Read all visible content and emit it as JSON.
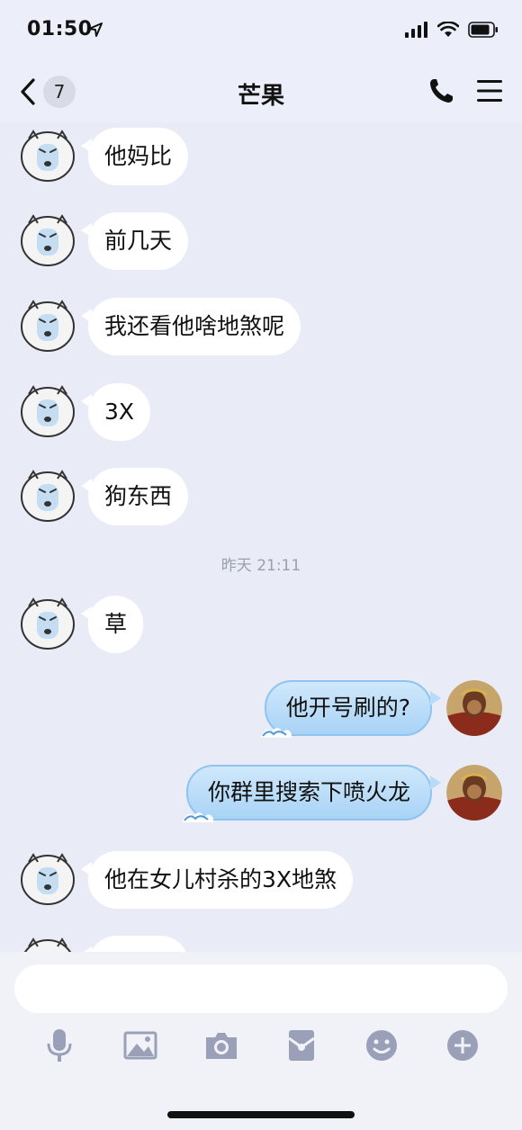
{
  "status_bar": {
    "time": "01:50"
  },
  "header": {
    "back_count": "7",
    "title": "芒果"
  },
  "messages": [
    {
      "side": "left",
      "text": "他妈比"
    },
    {
      "side": "left",
      "text": "前几天"
    },
    {
      "side": "left",
      "text": "我还看他啥地煞呢"
    },
    {
      "side": "left",
      "text": "3X"
    },
    {
      "side": "left",
      "text": "狗东西"
    },
    {
      "side": "left",
      "text": "草"
    },
    {
      "side": "right",
      "text": "他开号刷的?"
    },
    {
      "side": "right",
      "text": "你群里搜索下喷火龙"
    },
    {
      "side": "left",
      "text": "他在女儿村杀的3X地煞"
    }
  ],
  "timestamp": "昨天 21:11",
  "input": {
    "placeholder": "",
    "value": ""
  },
  "toolbar_icons": [
    "microphone-icon",
    "image-icon",
    "camera-icon",
    "red-packet-icon",
    "emoji-icon",
    "plus-icon"
  ],
  "colors": {
    "background": "#e9ebf6",
    "bubble_left": "#ffffff",
    "bubble_right": "#bfe0f9",
    "icon": "#9aa0b8"
  }
}
